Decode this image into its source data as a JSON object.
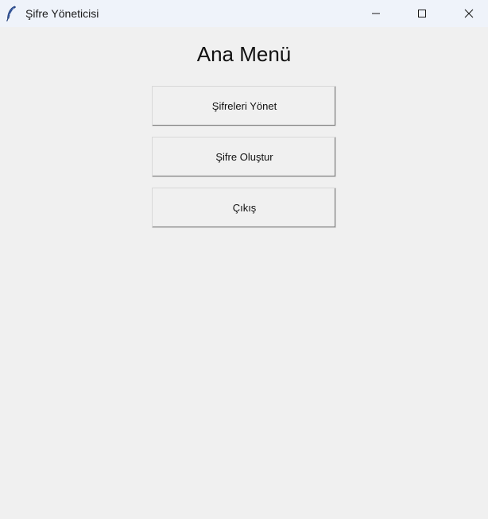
{
  "window": {
    "title": "Şifre Yöneticisi",
    "icon": "feather-icon",
    "controls": [
      "minimize-icon",
      "maximize-icon",
      "close-icon"
    ]
  },
  "main": {
    "title": "Ana Menü",
    "buttons": [
      {
        "label": "Şifreleri Yönet"
      },
      {
        "label": "Şifre Oluştur"
      },
      {
        "label": "Çıkış"
      }
    ]
  },
  "colors": {
    "window_bg": "#f0f0f0",
    "titlebar_bg": "#eff3fa",
    "text": "#111111"
  }
}
